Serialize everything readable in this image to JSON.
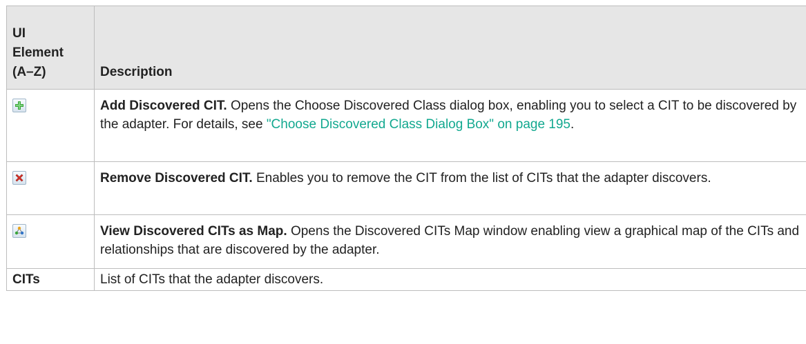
{
  "table": {
    "headers": {
      "element": "UI Element (A–Z)",
      "element_lines": [
        "UI",
        "Element",
        "(A–Z)"
      ],
      "description": "Description"
    },
    "rows": [
      {
        "element_icon": "add-plus-icon",
        "term": "Add Discovered CIT.",
        "text_before_link": " Opens the Choose Discovered Class dialog box, enabling you to select a CIT to be discovered by the adapter. For details, see ",
        "link": "\"Choose Discovered Class Dialog Box\" on page 195",
        "text_after_link": "."
      },
      {
        "element_icon": "remove-x-icon",
        "term": "Remove Discovered CIT.",
        "text": " Enables you to remove the CIT from the list of CITs that the adapter discovers."
      },
      {
        "element_icon": "map-view-icon",
        "term": "View Discovered CITs as Map.",
        "text": " Opens the Discovered CITs Map window enabling view a graphical map of the CITs and relationships that are discovered by the adapter."
      },
      {
        "element_label": "CITs",
        "text": "List of CITs that the adapter discovers."
      }
    ]
  },
  "colors": {
    "header_bg": "#e6e6e6",
    "border": "#bdbdbd",
    "link": "#12a88f",
    "plus_green": "#3aa53a",
    "x_red": "#d9342b"
  }
}
